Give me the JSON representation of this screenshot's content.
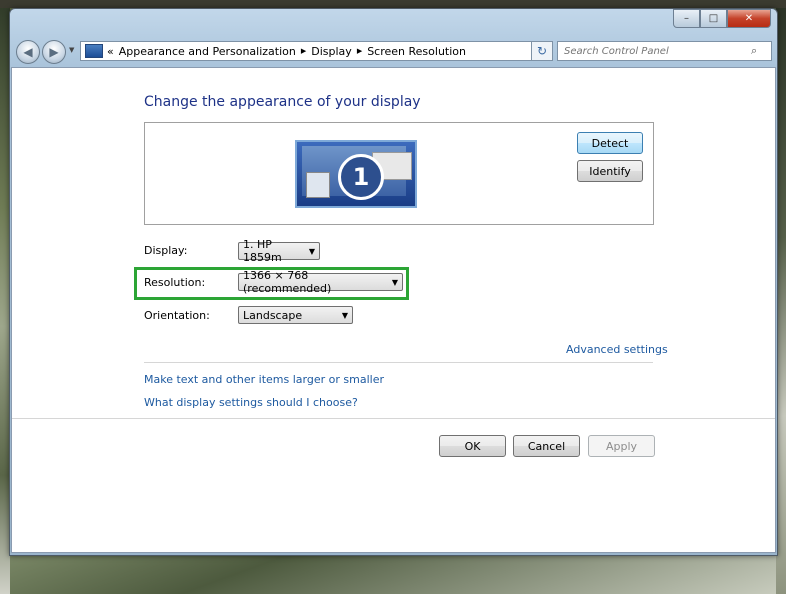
{
  "window": {
    "minimize": "–",
    "maximize": "□",
    "close": "✕"
  },
  "navigation": {
    "back_icon": "◀",
    "forward_icon": "▶",
    "breadcrumb": [
      "Appearance and Personalization",
      "Display",
      "Screen Resolution"
    ],
    "prefix": "«",
    "separator": "▶",
    "search_placeholder": "Search Control Panel"
  },
  "main": {
    "title": "Change the appearance of your display",
    "monitor_number": "1",
    "detect_button": "Detect",
    "identify_button": "Identify",
    "display_label": "Display:",
    "display_value": "1. HP 1859m",
    "resolution_label": "Resolution:",
    "resolution_value": "1366 × 768 (recommended)",
    "orientation_label": "Orientation:",
    "orientation_value": "Landscape",
    "advanced_link": "Advanced settings",
    "link_text_size": "Make text and other items larger or smaller",
    "link_display_settings": "What display settings should I choose?",
    "ok_button": "OK",
    "cancel_button": "Cancel",
    "apply_button": "Apply"
  },
  "colors": {
    "title": "#1e3287",
    "link": "#1e5aa0",
    "highlight": "#2ca535"
  }
}
